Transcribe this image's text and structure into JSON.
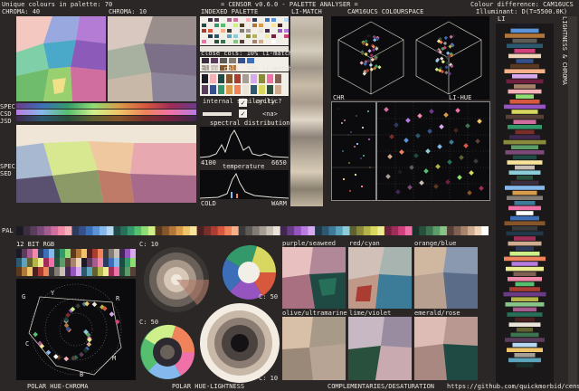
{
  "header": {
    "unique_colours": "Unique colours in palette: 70",
    "title": "= CENSOR v0.6.0 - PALETTE ANALYSER =",
    "colour_difference": "Colour difference: CAM16UCS",
    "illuminant": "Illuminant: D(T=5500.0K)"
  },
  "labels": {
    "chroma40": "CHROMA: 40",
    "chroma10": "CHROMA: 10",
    "indexed_palette": "INDEXED PALETTE",
    "li_match": "LI-MATCH",
    "cam16ucs_space": "CAM16UCS COLOURSPACE",
    "li": "LI",
    "spec": "SPEC",
    "csd": "CSD",
    "jsd": "JSD",
    "sed": "SED",
    "close_cols_10": "close cols: 10% li-match",
    "close_cols_70": "close cols: 70% li-match",
    "internal_similarity": "internal similarity",
    "cyclic": "cyclic?",
    "na": "<na>",
    "spectral_distribution": "spectral distribution",
    "wl_min": "4100",
    "wl_max": "6650",
    "temperature": "temperature",
    "cold": "COLD",
    "warm": "WARM",
    "chr": "CHR",
    "li_hue": "LI-HUE",
    "pal": "PAL",
    "bit12": "12 BIT RGB",
    "c10a": "C: 10",
    "c50a": "C: 50",
    "c50b": "C: 50",
    "c10b": "C: 10",
    "purple_seaweed": "purple/seaweed",
    "red_cyan": "red/cyan",
    "orange_blue": "orange/blue",
    "olive_ultramarine": "olive/ultramarine",
    "lime_violet": "lime/violet",
    "emerald_rose": "emerald/rose",
    "polar_hue_chroma": "POLAR HUE-CHROMA",
    "polar_hue_lightness": "POLAR HUE-LIGHTNESS",
    "complementaries": "COMPLEMENTARIES/DESATURATION",
    "github": "https://github.com/quickmorbid/censor",
    "lightness_chroma": "LIGHTNESS & CHROMA",
    "axis_g": "G",
    "axis_y": "Y",
    "axis_r": "R",
    "axis_c": "C",
    "axis_m": "M",
    "axis_b": "B"
  },
  "colors": {
    "bg": "#2b2726",
    "panel": "#0b0b0d",
    "text": "#e8e4dc"
  },
  "palette": [
    "#1c1a24",
    "#3b2e3f",
    "#5a3d5c",
    "#7b4a78",
    "#a45b8e",
    "#d06ea0",
    "#f08aa8",
    "#f5b0b8",
    "#2c3a5c",
    "#35508a",
    "#3d6fb8",
    "#5b93d8",
    "#85b8ec",
    "#b6daf6",
    "#1f4a44",
    "#26705a",
    "#33996a",
    "#55bf6f",
    "#8fdc74",
    "#cfef8a",
    "#5a3a1e",
    "#86552a",
    "#b27638",
    "#d89c4a",
    "#f0c468",
    "#f8e49a",
    "#4a2020",
    "#7a2e2a",
    "#aa3c32",
    "#d8583e",
    "#f0835a",
    "#f6b08a",
    "#3a3a3a",
    "#5e5a56",
    "#827c74",
    "#a69e94",
    "#c8c0b4",
    "#eae4d8",
    "#402850",
    "#6a3c88",
    "#9554c0",
    "#b87ce0",
    "#d8a8f0",
    "#203848",
    "#2c5870",
    "#3c7c98",
    "#5ca4bc",
    "#8cccd8",
    "#606030",
    "#8a8a3c",
    "#b4b448",
    "#d8d860",
    "#ecec90",
    "#702040",
    "#a02c58",
    "#d0407c",
    "#f070a8",
    "#183028",
    "#28503c",
    "#3c7450",
    "#5c9c68",
    "#88c488",
    "#584038",
    "#806050",
    "#a8846c",
    "#d0ac90",
    "#f0d4b8",
    "#ffffff"
  ]
}
